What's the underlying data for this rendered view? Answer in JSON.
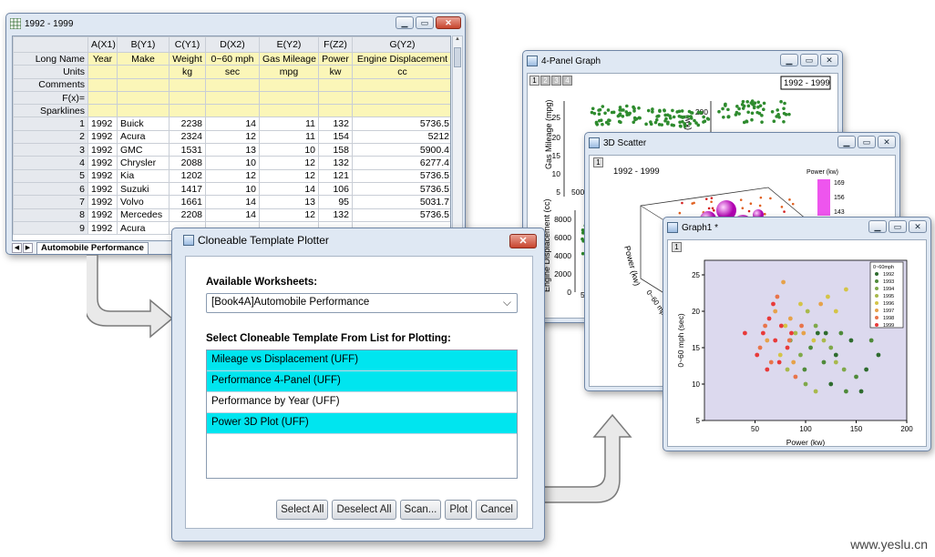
{
  "worksheet": {
    "title": "1992 - 1999",
    "col_headers": [
      "",
      "A(X1)",
      "B(Y1)",
      "C(Y1)",
      "D(X2)",
      "E(Y2)",
      "F(Z2)",
      "G(Y2)"
    ],
    "meta_rows": [
      {
        "label": "Long Name",
        "cells": [
          "Year",
          "Make",
          "Weight",
          "0~60 mph",
          "Gas Mileage",
          "Power",
          "Engine Displacement"
        ]
      },
      {
        "label": "Units",
        "cells": [
          "",
          "",
          "kg",
          "sec",
          "mpg",
          "kw",
          "cc"
        ]
      },
      {
        "label": "Comments",
        "cells": [
          "",
          "",
          "",
          "",
          "",
          "",
          ""
        ]
      },
      {
        "label": "F(x)=",
        "cells": [
          "",
          "",
          "",
          "",
          "",
          "",
          ""
        ]
      },
      {
        "label": "Sparklines",
        "cells": [
          "",
          "",
          "",
          "",
          "",
          "",
          ""
        ]
      }
    ],
    "rows": [
      {
        "n": "1",
        "cells": [
          "1992",
          "Buick",
          "2238",
          "14",
          "11",
          "132",
          "5736.5"
        ]
      },
      {
        "n": "2",
        "cells": [
          "1992",
          "Acura",
          "2324",
          "12",
          "11",
          "154",
          "5212"
        ]
      },
      {
        "n": "3",
        "cells": [
          "1992",
          "GMC",
          "1531",
          "13",
          "10",
          "158",
          "5900.4"
        ]
      },
      {
        "n": "4",
        "cells": [
          "1992",
          "Chrysler",
          "2088",
          "10",
          "12",
          "132",
          "6277.4"
        ]
      },
      {
        "n": "5",
        "cells": [
          "1992",
          "Kia",
          "1202",
          "12",
          "12",
          "121",
          "5736.5"
        ]
      },
      {
        "n": "6",
        "cells": [
          "1992",
          "Suzuki",
          "1417",
          "10",
          "14",
          "106",
          "5736.5"
        ]
      },
      {
        "n": "7",
        "cells": [
          "1992",
          "Volvo",
          "1661",
          "14",
          "13",
          "95",
          "5031.7"
        ]
      },
      {
        "n": "8",
        "cells": [
          "1992",
          "Mercedes",
          "2208",
          "14",
          "12",
          "132",
          "5736.5"
        ]
      },
      {
        "n": "9",
        "cells": [
          "1992",
          "Acura",
          "",
          "",
          "",
          "",
          ""
        ]
      }
    ],
    "sheet_tab": "Automobile Performance"
  },
  "graph4": {
    "title": "4-Panel Graph",
    "layers": [
      "1",
      "2",
      "3",
      "4"
    ],
    "legend_text": "1992 - 1999",
    "ylabel_left": "Gas Mileage (mpg)",
    "ylabel_right": "Power (kw)",
    "left_ticks": [
      "25",
      "20",
      "15",
      "10",
      "5",
      "500"
    ],
    "right_ticks": [
      "200",
      "150"
    ],
    "low_ticks": [
      "8000",
      "6000",
      "4000",
      "2000",
      "0",
      "500"
    ],
    "low_label": "Engine Displacement (cc)"
  },
  "graph3d": {
    "title": "3D Scatter",
    "layer": "1",
    "subtitle": "1992 - 1999",
    "legend_title": "Power (kw)",
    "legend_ticks": [
      "169",
      "156",
      "143"
    ],
    "ylabel": "Power (kw)",
    "xlabel": "0~60 mph (sec)"
  },
  "graph1": {
    "title": "Graph1 *",
    "layer": "1"
  },
  "dialog": {
    "title": "Cloneable Template Plotter",
    "worksheets_label": "Available Worksheets:",
    "worksheet_value": "[Book4A]Automobile Performance",
    "template_label": "Select Cloneable Template From List for Plotting:",
    "templates": [
      {
        "label": "Mileage vs Displacement (UFF)",
        "selected": true
      },
      {
        "label": "Performance 4-Panel (UFF)",
        "selected": true
      },
      {
        "label": "Performance by Year (UFF)",
        "selected": false
      },
      {
        "label": "Power 3D Plot (UFF)",
        "selected": true
      }
    ],
    "buttons": {
      "select_all": "Select All",
      "deselect_all": "Deselect All",
      "scan": "Scan...",
      "plot": "Plot",
      "cancel": "Cancel"
    }
  },
  "chart_data": {
    "type": "scatter",
    "xlabel": "Power (kw)",
    "ylabel": "0~60 mph (sec)",
    "xlim": [
      0,
      200
    ],
    "ylim": [
      5,
      27
    ],
    "x_ticks": [
      50,
      100,
      150,
      200
    ],
    "y_ticks": [
      5,
      10,
      15,
      20,
      25
    ],
    "legend_title": "0~60mph",
    "legend_placement": "top-right",
    "series": [
      {
        "name": "1992",
        "color": "#2e6b2e",
        "points": [
          [
            112,
            17
          ],
          [
            130,
            14
          ],
          [
            145,
            16
          ],
          [
            160,
            12
          ],
          [
            172,
            14
          ],
          [
            155,
            9
          ],
          [
            125,
            10
          ],
          [
            120,
            17
          ]
        ]
      },
      {
        "name": "1993",
        "color": "#4f8a3a",
        "points": [
          [
            105,
            15
          ],
          [
            118,
            13
          ],
          [
            135,
            17
          ],
          [
            150,
            11
          ],
          [
            165,
            16
          ],
          [
            140,
            9
          ],
          [
            99,
            12
          ]
        ]
      },
      {
        "name": "1994",
        "color": "#7fa84a",
        "points": [
          [
            95,
            14
          ],
          [
            110,
            18
          ],
          [
            125,
            15
          ],
          [
            138,
            12
          ],
          [
            100,
            10
          ],
          [
            85,
            16
          ]
        ]
      },
      {
        "name": "1995",
        "color": "#a8b94c",
        "points": [
          [
            90,
            17
          ],
          [
            102,
            20
          ],
          [
            118,
            16
          ],
          [
            130,
            13
          ],
          [
            82,
            12
          ],
          [
            110,
            9
          ]
        ]
      },
      {
        "name": "1996",
        "color": "#d4c447",
        "points": [
          [
            80,
            18
          ],
          [
            95,
            21
          ],
          [
            108,
            16
          ],
          [
            122,
            22
          ],
          [
            140,
            23
          ],
          [
            75,
            14
          ],
          [
            130,
            20
          ]
        ]
      },
      {
        "name": "1997",
        "color": "#e6a24a",
        "points": [
          [
            70,
            20
          ],
          [
            85,
            19
          ],
          [
            98,
            17
          ],
          [
            115,
            21
          ],
          [
            62,
            16
          ],
          [
            88,
            13
          ],
          [
            78,
            24
          ]
        ]
      },
      {
        "name": "1998",
        "color": "#e8744a",
        "points": [
          [
            60,
            18
          ],
          [
            72,
            22
          ],
          [
            84,
            16
          ],
          [
            96,
            18
          ],
          [
            55,
            15
          ],
          [
            66,
            13
          ],
          [
            90,
            11
          ]
        ]
      },
      {
        "name": "1999",
        "color": "#e83a3a",
        "points": [
          [
            58,
            17
          ],
          [
            64,
            19
          ],
          [
            70,
            16
          ],
          [
            76,
            18
          ],
          [
            82,
            15
          ],
          [
            68,
            21
          ],
          [
            52,
            14
          ],
          [
            74,
            13
          ],
          [
            62,
            12
          ],
          [
            86,
            17
          ],
          [
            40,
            17
          ]
        ]
      }
    ]
  }
}
